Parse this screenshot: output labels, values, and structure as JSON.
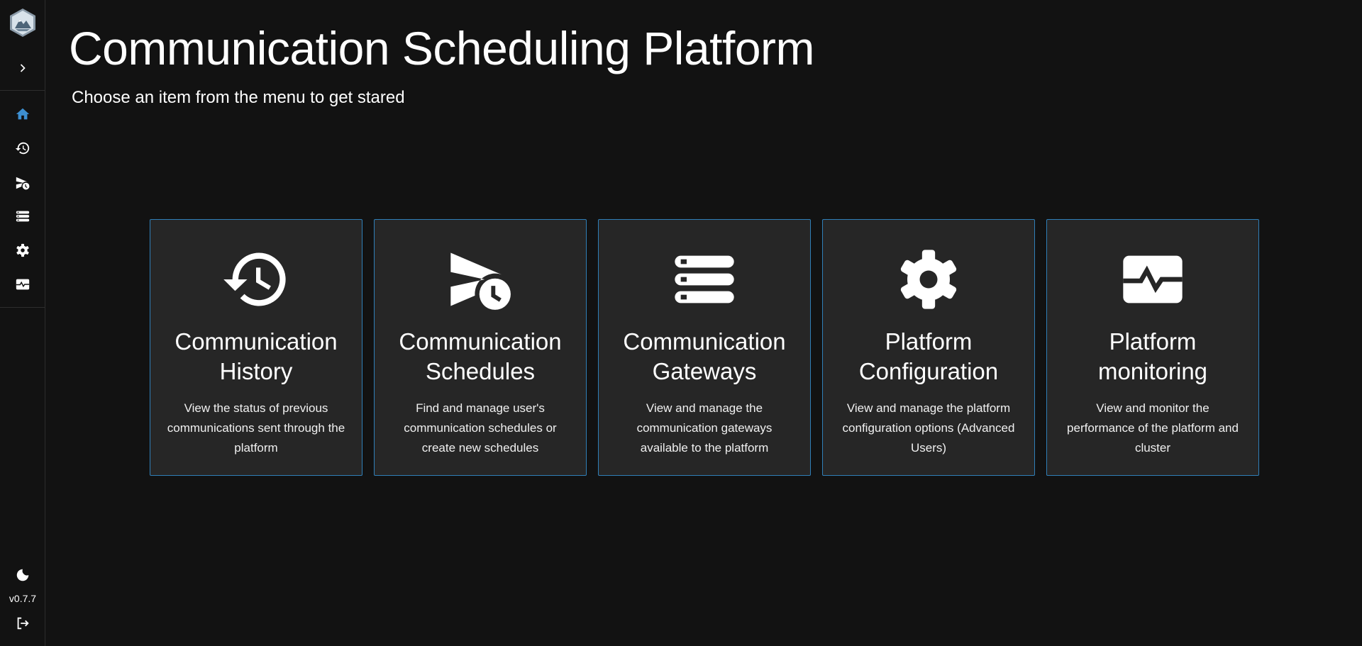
{
  "sidebar": {
    "expand_icon": "chevron-right-icon",
    "nav": [
      {
        "icon": "home-icon",
        "active": true
      },
      {
        "icon": "history-icon"
      },
      {
        "icon": "schedule-send-icon"
      },
      {
        "icon": "gateways-icon"
      },
      {
        "icon": "gear-icon"
      },
      {
        "icon": "monitor-heart-icon"
      }
    ],
    "theme_icon": "moon-icon",
    "version": "v0.7.7",
    "logout_icon": "logout-icon"
  },
  "header": {
    "title": "Communication Scheduling Platform",
    "subtitle": "Choose an item from the menu to get stared"
  },
  "cards": [
    {
      "icon": "history-icon",
      "title": "Communication History",
      "description": "View the status of previous communications sent through the platform"
    },
    {
      "icon": "schedule-send-icon",
      "title": "Communication Schedules",
      "description": "Find and manage user's communication schedules or create new schedules"
    },
    {
      "icon": "gateways-icon",
      "title": "Communication Gateways",
      "description": "View and manage the communication gateways available to the platform"
    },
    {
      "icon": "gear-icon",
      "title": "Platform Configuration",
      "description": "View and manage the platform configuration options (Advanced Users)"
    },
    {
      "icon": "monitor-heart-icon",
      "title": "Platform monitoring",
      "description": "View and monitor the performance of the platform and cluster"
    }
  ],
  "colors": {
    "background": "#121212",
    "card_background": "#262626",
    "card_border": "#2f7fb8",
    "active_nav": "#3d8fd1",
    "text": "#ffffff"
  }
}
